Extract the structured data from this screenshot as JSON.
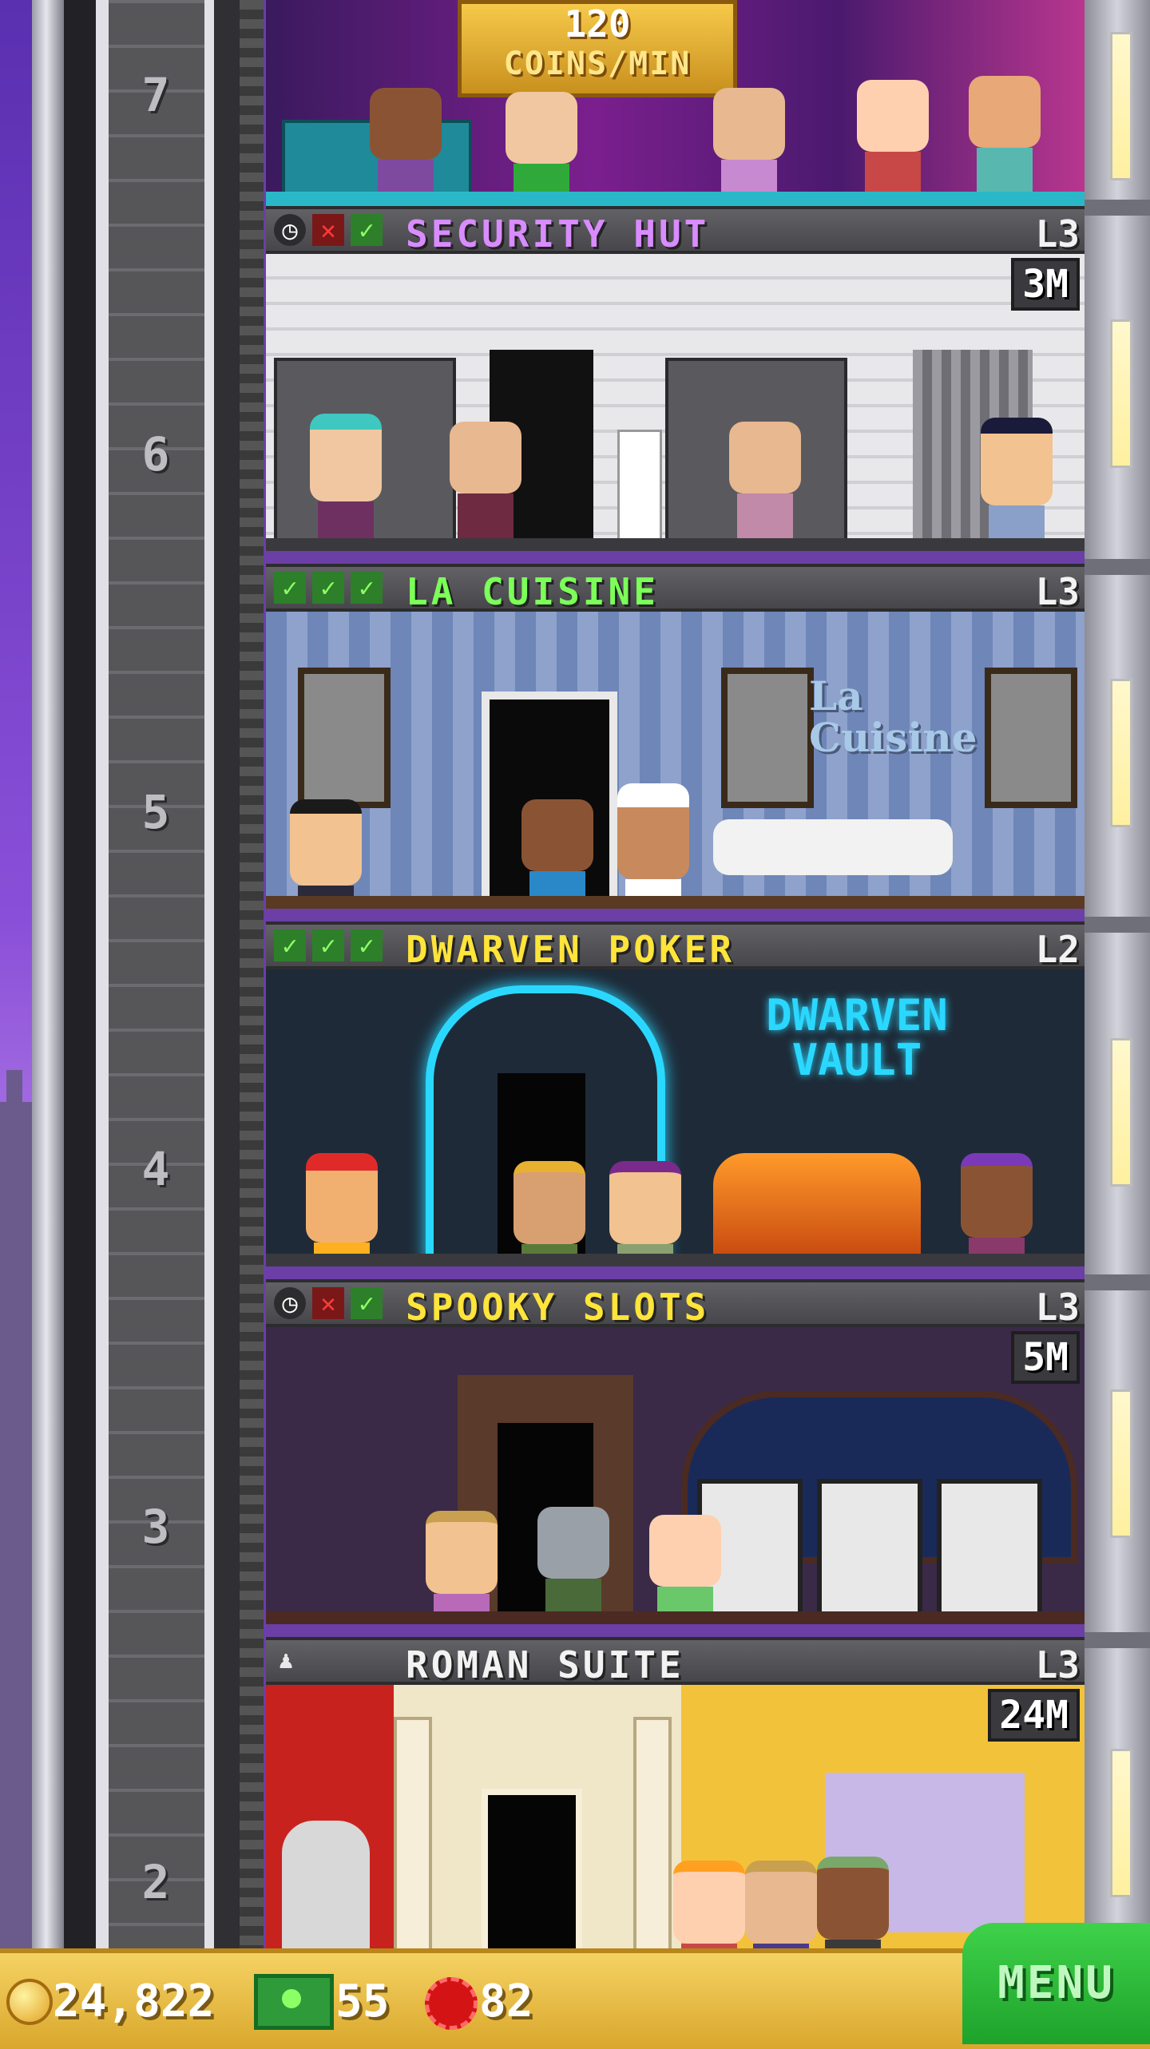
{
  "top_floor": {
    "number": "7",
    "income_line1": "120",
    "income_line2": "COINS/MIN"
  },
  "floors": [
    {
      "number": "6",
      "name": "SECURITY HUT",
      "level": "L3",
      "badge": "3M",
      "color": "#d98cff"
    },
    {
      "number": "5",
      "name": "LA CUISINE",
      "level": "L3",
      "badge": "",
      "color": "#7cff58"
    },
    {
      "number": "4",
      "name": "DWARVEN POKER",
      "level": "L2",
      "badge": "",
      "color": "#ffe43a"
    },
    {
      "number": "3",
      "name": "SPOOKY SLOTS",
      "level": "L3",
      "badge": "5M",
      "color": "#ffe43a"
    },
    {
      "number": "2",
      "name": "ROMAN SUITE",
      "level": "L3",
      "badge": "24M",
      "color": "#f2f2f2"
    }
  ],
  "signs": {
    "la_cuisine": "La Cuisine",
    "dwarven_vault_line1": "DWARVEN",
    "dwarven_vault_line2": "VAULT"
  },
  "status": {
    "coins": "24,822",
    "bux": "55",
    "chips": "82"
  },
  "menu_label": "MENU"
}
